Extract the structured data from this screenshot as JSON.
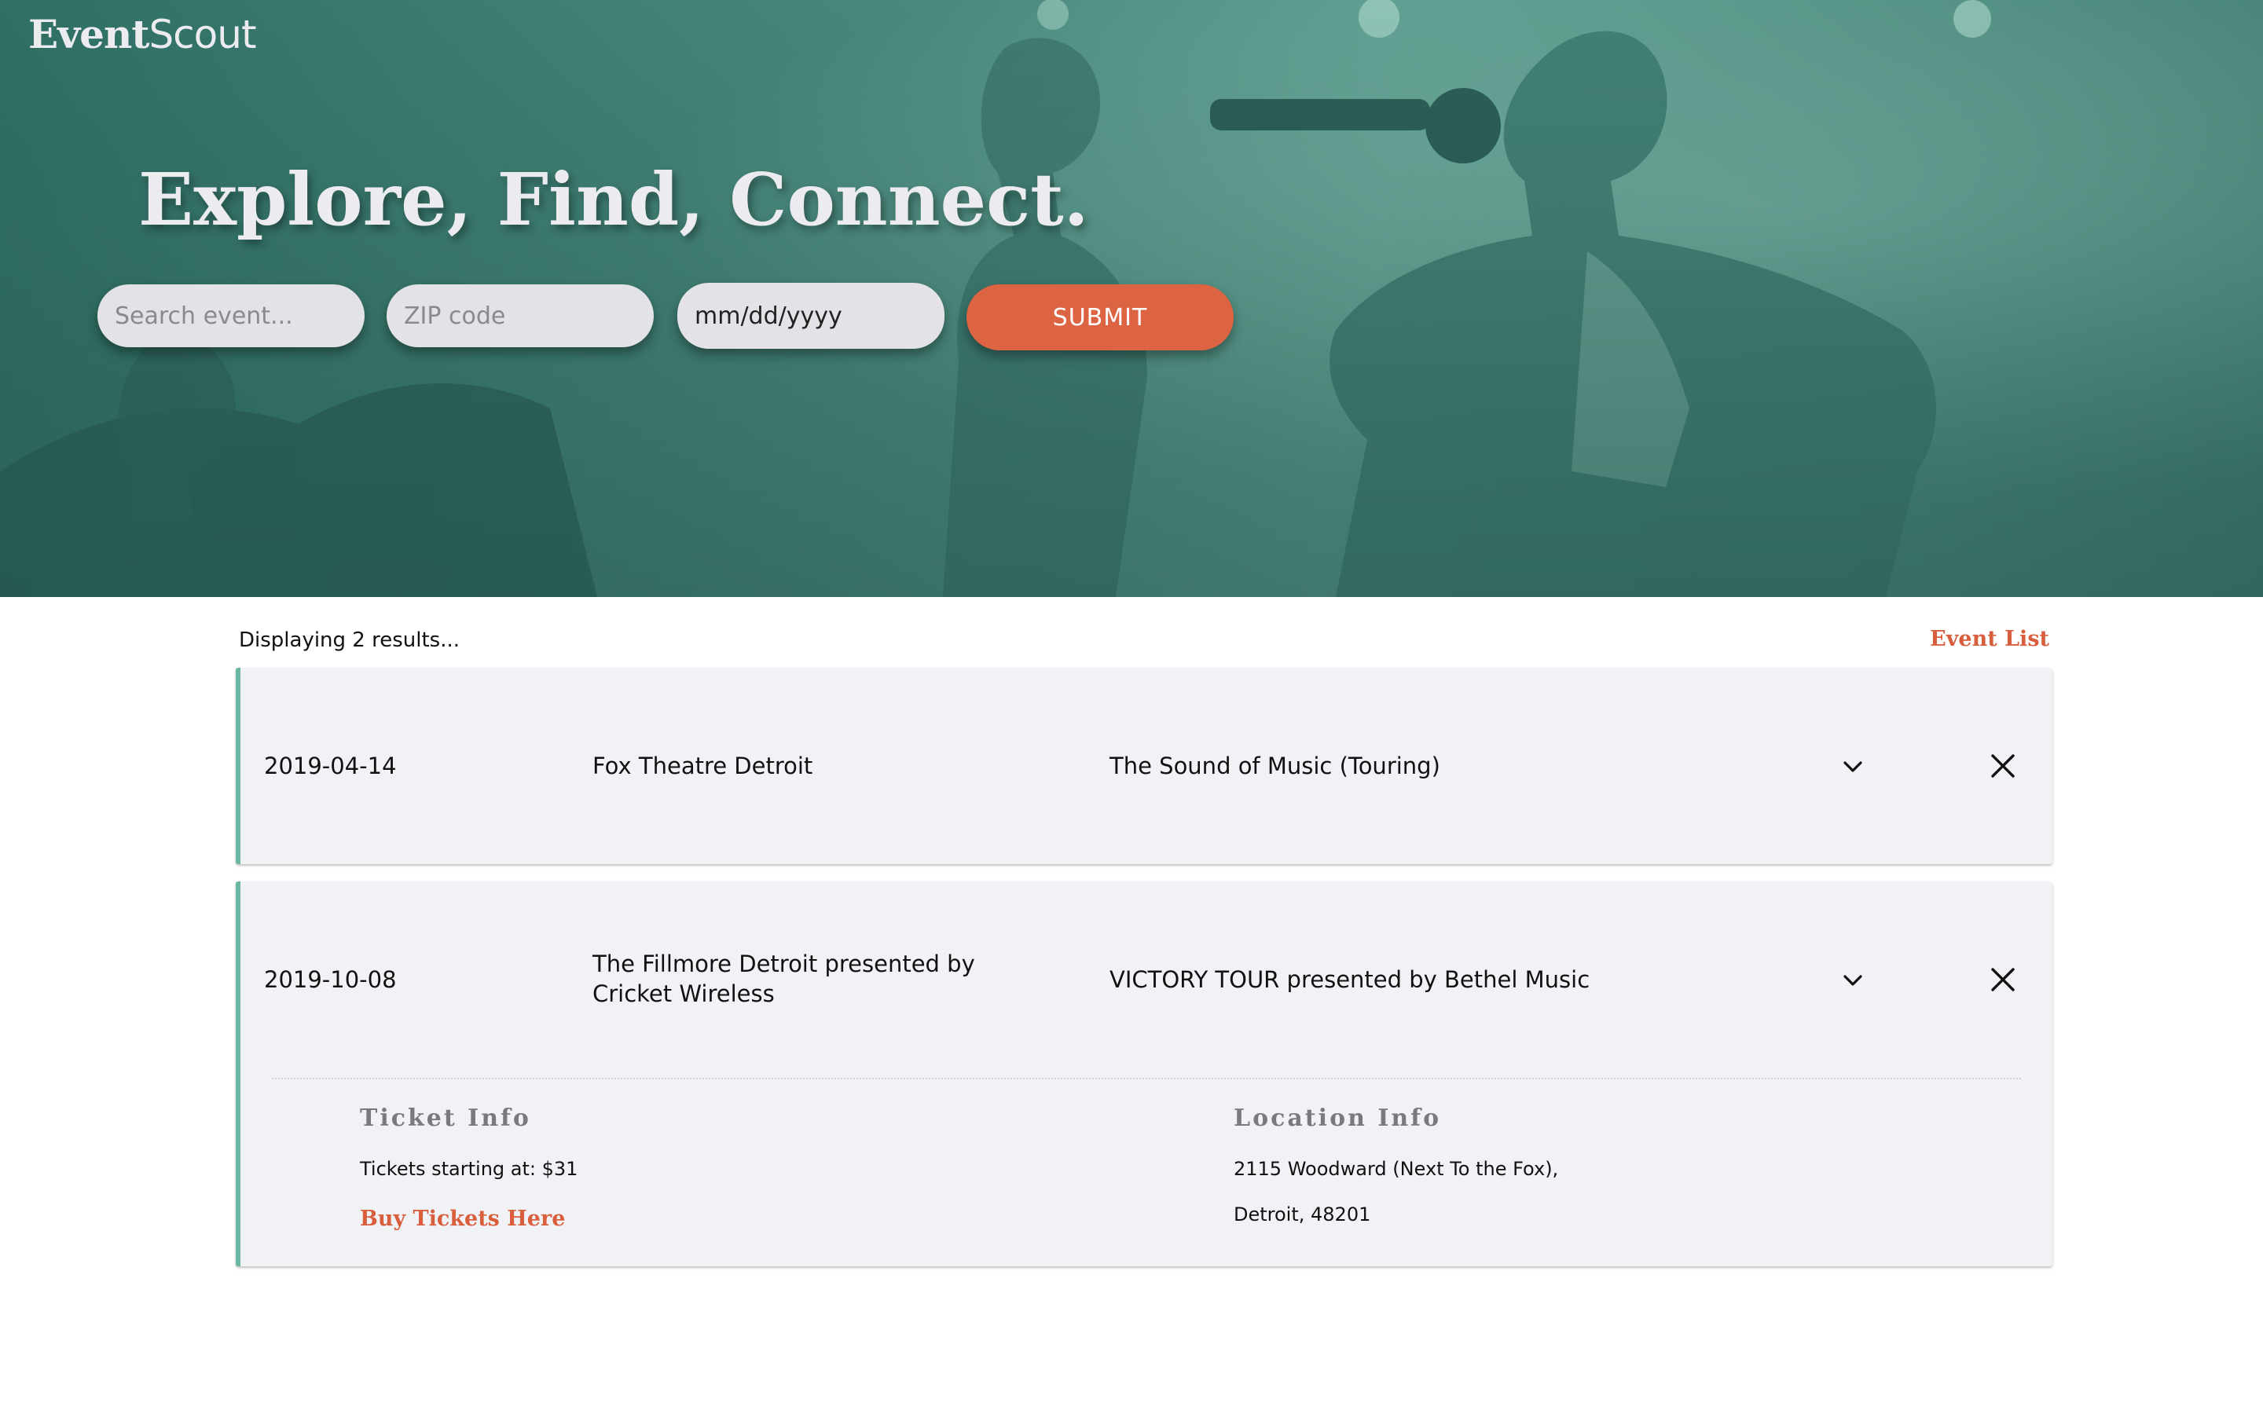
{
  "brand": {
    "name_bold": "Event",
    "name_light": "Scout"
  },
  "hero": {
    "title": "Explore, Find, Connect."
  },
  "search": {
    "event_placeholder": "Search event...",
    "zip_placeholder": "ZIP code",
    "date_value": "mm/dd/yyyy",
    "submit_label": "SUBMIT"
  },
  "results": {
    "count_text": "Displaying 2 results...",
    "event_list_label": "Event List",
    "events": [
      {
        "date": "2019-04-14",
        "venue": "Fox Theatre Detroit",
        "name": "The Sound of Music (Touring)",
        "expanded": false
      },
      {
        "date": "2019-10-08",
        "venue": "The Fillmore Detroit presented by Cricket Wireless",
        "name": "VICTORY TOUR presented by Bethel Music",
        "expanded": true,
        "ticket_info_heading": "Ticket Info",
        "ticket_price_text": "Tickets starting at: $31",
        "buy_label": "Buy Tickets Here",
        "location_info_heading": "Location Info",
        "address_line1": "2115 Woodward (Next To the Fox),",
        "address_line2": "Detroit, 48201"
      }
    ]
  },
  "colors": {
    "hero_tint": "#4a8a7e",
    "accent": "#dc6442",
    "card_bg": "#f1f2f6",
    "card_border": "#6bb6a3"
  },
  "icons": {
    "expand": "chevron-down-icon",
    "remove": "close-icon"
  }
}
